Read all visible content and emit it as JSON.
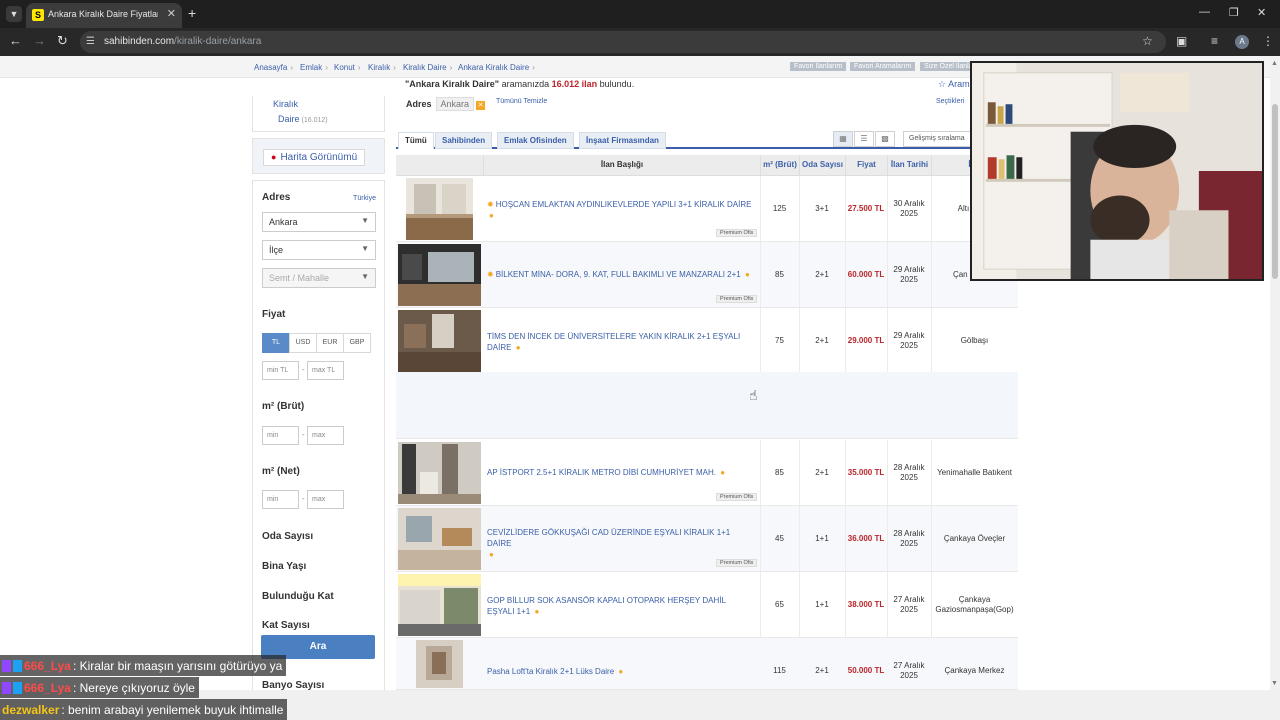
{
  "browser": {
    "tab_title": "Ankara Kiralık Daire Fiyatları ve",
    "favicon_letter": "S",
    "url_host": "sahibinden.com",
    "url_path": "/kiralik-daire/ankara",
    "profile_initial": "A"
  },
  "breadcrumb": [
    "Anasayfa",
    "Emlak",
    "Konut",
    "Kiralık",
    "Kiralık Daire",
    "Ankara Kiralık Daire"
  ],
  "top_links": [
    "Favori İlanlarım",
    "Favori Aramalarım",
    "Size Özel İlanla"
  ],
  "summary": {
    "query": "\"Ankara Kiralık Daire\"",
    "middle": " aramanızda ",
    "count": "16.012 ilan",
    "suffix": " bulundu.",
    "save_search": "Aram"
  },
  "address_filter": {
    "label": "Adres",
    "tag": "Ankara",
    "clear_all": "Tümünü Temizle",
    "selected": "Seçtikleri"
  },
  "sidebar": {
    "category_parent": "Kiralık",
    "category_child": "Daire",
    "category_count": "(16.012)",
    "map_button": "Harita Görünümü",
    "adres_title": "Adres",
    "adres_scope": "Türkiye",
    "city_select": "Ankara",
    "district_select": "İlçe",
    "neighborhood_select": "Semt / Mahalle",
    "price_title": "Fiyat",
    "currencies": [
      "TL",
      "USD",
      "EUR",
      "GBP"
    ],
    "min_price_placeholder": "min TL",
    "max_price_placeholder": "max TL",
    "gross_m2_title": "m² (Brüt)",
    "net_m2_title": "m² (Net)",
    "min_placeholder": "min",
    "max_placeholder": "max",
    "collapsed_filters": [
      "Oda Sayısı",
      "Bina Yaşı",
      "Bulunduğu Kat",
      "Kat Sayısı",
      "Banyo Sayısı"
    ],
    "search_button": "Ara"
  },
  "listing_tabs": [
    "Tümü",
    "Sahibinden",
    "Emlak Ofisinden",
    "İnşaat Firmasından"
  ],
  "sort_label": "Gelişmiş sıralama",
  "table": {
    "headers": [
      "İlan Başlığı",
      "m² (Brüt)",
      "Oda Sayısı",
      "Fiyat",
      "İlan Tarihi",
      "İlçe"
    ],
    "rows": [
      {
        "title": "HOŞCAN EMLAKTAN AYDINLIKEVLERDE YAPILI 3+1 KİRALIK DAİRE",
        "m2": "125",
        "rooms": "3+1",
        "price": "27.500 TL",
        "date": "30 Aralık 2025",
        "district": "Altı Aydın",
        "badge": "Premium Ofis"
      },
      {
        "title": "BİLKENT MİNA- DORA, 9. KAT, FULL BAKIMLI VE MANZARALI 2+1",
        "m2": "85",
        "rooms": "2+1",
        "price": "60.000 TL",
        "date": "29 Aralık 2025",
        "district": "Çan Merkez",
        "badge": "Premium Ofis"
      },
      {
        "title": "TİMS DEN İNCEK DE ÜNİVERSİTELERE YAKIN KİRALIK 2+1 EŞYALI DAİRE",
        "m2": "75",
        "rooms": "2+1",
        "price": "29.000 TL",
        "date": "29 Aralık 2025",
        "district": "Gölbaşı",
        "badge": ""
      },
      {
        "title": "AP İSTPORT 2.5+1 KİRALIK METRO DİBİ CUMHURİYET MAH.",
        "m2": "85",
        "rooms": "2+1",
        "price": "35.000 TL",
        "date": "28 Aralık 2025",
        "district": "Yenimahalle Batıkent",
        "badge": "Premium Ofis"
      },
      {
        "title": "CEVİZLİDERE GÖKKUŞAĞI CAD ÜZERİNDE EŞYALI KİRALIK 1+1 DAİRE",
        "m2": "45",
        "rooms": "1+1",
        "price": "36.000 TL",
        "date": "28 Aralık 2025",
        "district": "Çankaya Öveçler",
        "badge": "Premium Ofis"
      },
      {
        "title": "GOP BİLLUR SOK ASANSÖR KAPALI OTOPARK HERŞEY DAHİL EŞYALI 1+1",
        "m2": "65",
        "rooms": "1+1",
        "price": "38.000 TL",
        "date": "27 Aralık 2025",
        "district": "Çankaya Gaziosmanpaşa(Gop)",
        "badge": ""
      },
      {
        "title": "Pasha Loft'ta Kiralık 2+1 Lüks Daire",
        "m2": "115",
        "rooms": "2+1",
        "price": "50.000 TL",
        "date": "27 Aralık 2025",
        "district": "Çankaya Merkez",
        "badge": ""
      }
    ]
  },
  "chat": [
    {
      "user": "666_Lya",
      "message": ": Kiralar bir maaşın yarısını götürüyo ya"
    },
    {
      "user": "666_Lya",
      "message": ": Nereye çıkıyoruz öyle"
    },
    {
      "user": "dezwalker",
      "message": ": benim arabayi yenilemek buyuk ihtimalle"
    }
  ],
  "colors": {
    "link": "#3a5fa8",
    "price": "#b8252a",
    "accent_button": "#4a7fc1",
    "brand_yellow": "#ffe800"
  }
}
